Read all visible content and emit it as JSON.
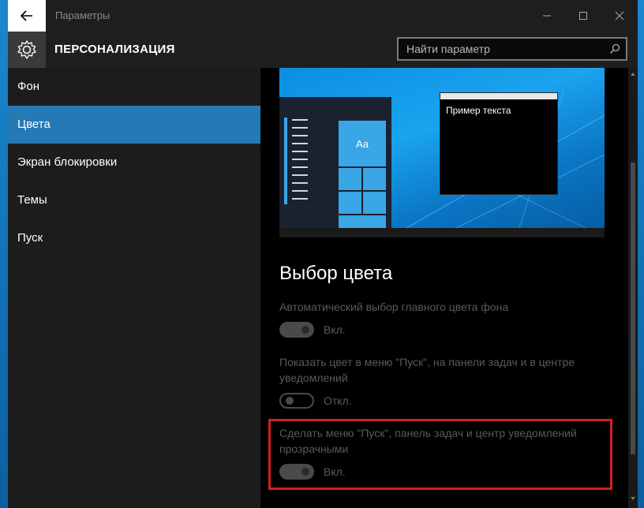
{
  "window": {
    "title": "Параметры"
  },
  "header": {
    "section_title": "ПЕРСОНАЛИЗАЦИЯ",
    "search_placeholder": "Найти параметр"
  },
  "sidebar": {
    "items": [
      {
        "label": "Фон",
        "active": false
      },
      {
        "label": "Цвета",
        "active": true
      },
      {
        "label": "Экран блокировки",
        "active": false
      },
      {
        "label": "Темы",
        "active": false
      },
      {
        "label": "Пуск",
        "active": false
      }
    ]
  },
  "preview": {
    "sample_text": "Пример текста",
    "tile_label": "Aa"
  },
  "content": {
    "heading": "Выбор цвета",
    "settings": [
      {
        "label": "Автоматический выбор главного цвета фона",
        "state": "Вкл.",
        "on": true
      },
      {
        "label": "Показать цвет в меню \"Пуск\", на панели задач и в центре уведомлений",
        "state": "Откл.",
        "on": false
      },
      {
        "label": "Сделать меню \"Пуск\", панель задач и центр уведомлений прозрачными",
        "state": "Вкл.",
        "on": true
      }
    ]
  },
  "colors": {
    "accent": "#2579b5",
    "highlight_border": "#d41f1f"
  }
}
